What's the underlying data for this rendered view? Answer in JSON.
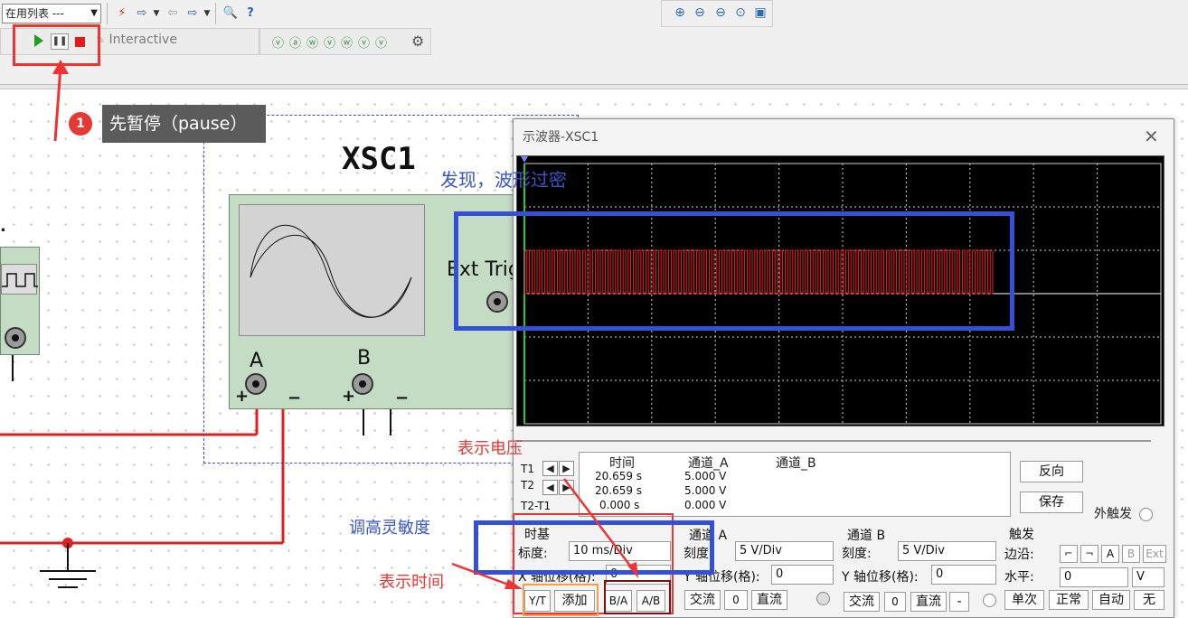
{
  "toolbar": {
    "list_combo_value": "在用列表 ---",
    "interactive_label": "Interactive"
  },
  "callout": {
    "badge_number": "1",
    "text": "先暂停（pause）"
  },
  "schematic": {
    "instrument_name": "XSC1",
    "ext_trig_label": "Ext Trig",
    "terminal_a_label": "A",
    "terminal_b_label": "B",
    "plus_sign": "+",
    "minus_sign": "−"
  },
  "oscilloscope": {
    "window_title": "示波器-XSC1",
    "cursor_table": {
      "headers": [
        "时间",
        "通道_A",
        "通道_B"
      ],
      "rows": [
        {
          "label": "T1",
          "time": "20.659 s",
          "channel_a": "5.000 V",
          "channel_b": ""
        },
        {
          "label": "T2",
          "time": "20.659 s",
          "channel_a": "5.000 V",
          "channel_b": ""
        },
        {
          "label": "T2-T1",
          "time": "0.000 s",
          "channel_a": "0.000 V",
          "channel_b": ""
        }
      ]
    },
    "reverse_button": "反向",
    "save_button": "保存",
    "ext_trigger_label": "外触发",
    "timebase": {
      "group_label": "时基",
      "scale_label": "标度:",
      "scale_value": "10 ms/Div",
      "x_offset_label": "X 轴位移(格):",
      "x_offset_value": "0",
      "yt_button": "Y/T",
      "add_button": "添加",
      "ba_button": "B/A",
      "ab_button": "A/B"
    },
    "channel_a": {
      "group_label": "通道 A",
      "scale_label": "刻度:",
      "scale_value": "5 V/Div",
      "y_offset_label": "Y 轴位移(格):",
      "y_offset_value": "0",
      "ac_button": "交流",
      "zero_button": "0",
      "dc_button": "直流"
    },
    "channel_b": {
      "group_label": "通道 B",
      "scale_label": "刻度:",
      "scale_value": "5 V/Div",
      "y_offset_label": "Y 轴位移(格):",
      "y_offset_value": "0",
      "ac_button": "交流",
      "zero_button": "0",
      "dc_button": "直流",
      "minus_button": "-"
    },
    "trigger": {
      "group_label": "触发",
      "edge_label": "边沿:",
      "edge_a": "A",
      "edge_b": "B",
      "edge_ext": "Ext",
      "level_label": "水平:",
      "level_value": "0",
      "level_unit": "V",
      "single_button": "单次",
      "normal_button": "正常",
      "auto_button": "自动",
      "none_button": "无"
    }
  },
  "annotations": {
    "waveform_dense": "发现，波形过密",
    "shows_voltage": "表示电压",
    "increase_sensitivity": "调高灵敏度",
    "shows_time": "表示时间"
  },
  "colors": {
    "annotation_red": "#ee3333",
    "annotation_blue": "#3350d6",
    "waveform_red": "#dd1f1f",
    "screen_bg": "#000000"
  }
}
